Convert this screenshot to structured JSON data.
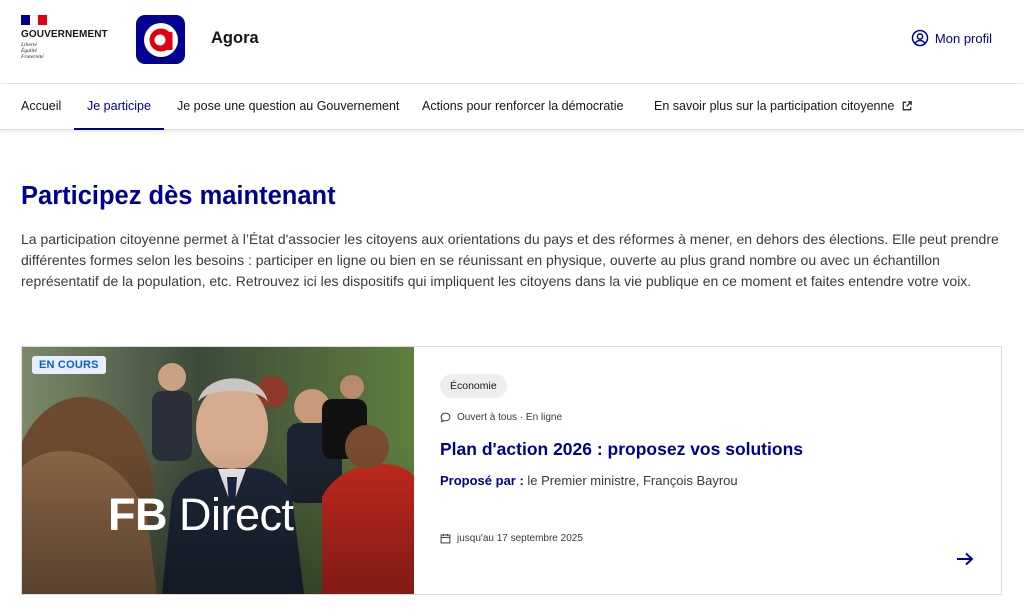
{
  "header": {
    "gov_title": "GOUVERNEMENT",
    "gov_motto": [
      "Liberté",
      "Égalité",
      "Fraternité"
    ],
    "app_name": "Agora",
    "profile_label": "Mon profil"
  },
  "nav": {
    "items": [
      {
        "label": "Accueil"
      },
      {
        "label": "Je participe"
      },
      {
        "label": "Je pose une question au Gouvernement"
      },
      {
        "label": "Actions pour renforcer la démocratie"
      },
      {
        "label": "En savoir plus sur la participation citoyenne"
      }
    ],
    "active_index": 1
  },
  "main": {
    "title": "Participez dès maintenant",
    "intro": "La participation citoyenne permet à l’État d'associer les citoyens aux orientations du pays et des réformes à mener, en dehors des élections. Elle peut prendre différentes formes selon les besoins : participer en ligne ou bien en se réunissant en physique, ouverte au plus grand nombre ou avec un échantillon représentatif de la population, etc. Retrouvez ici les dispositifs qui impliquent les citoyens dans la vie publique en ce moment et faites entendre votre voix."
  },
  "card": {
    "badge": "EN COURS",
    "image_caption_bold": "FB",
    "image_caption_rest": " Direct",
    "tag": "Économie",
    "meta": "Ouvert à tous · En ligne",
    "title": "Plan d'action 2026 : proposez vos solutions",
    "proposer_label": "Proposé par :",
    "proposer_value": " le Premier ministre, François Bayrou",
    "deadline": "jusqu'au 17 septembre 2025"
  },
  "colors": {
    "brand_blue": "#000091",
    "marianne_red": "#e1000f",
    "badge_bg": "#e8edff",
    "badge_text": "#0063cb"
  },
  "icons": {
    "profile": "user-circle-icon",
    "external": "external-link-icon",
    "meta": "speech-bubble-icon",
    "deadline": "calendar-icon",
    "arrow": "arrow-right-icon"
  }
}
